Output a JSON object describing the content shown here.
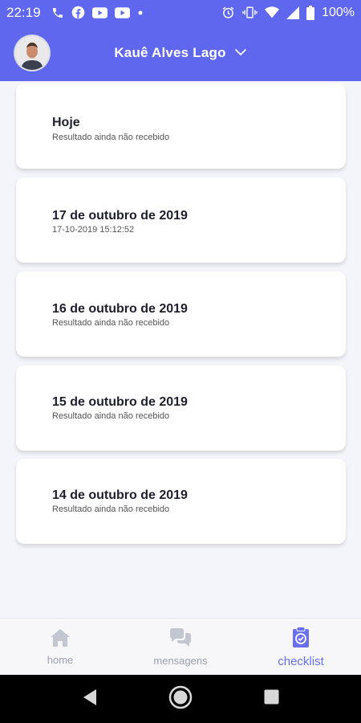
{
  "status_bar": {
    "time": "22:19",
    "battery": "100%",
    "left_icons": [
      "phone-icon",
      "facebook-icon",
      "youtube-icon",
      "youtube-icon",
      "dot-icon"
    ],
    "right_icons": [
      "alarm-icon",
      "vibrate-icon",
      "wifi-icon",
      "signal-icon",
      "battery-icon"
    ]
  },
  "header": {
    "user_name": "Kauê Alves Lago",
    "background": "#5f67ee"
  },
  "cards": [
    {
      "title": "Hoje",
      "subtitle": "Resultado ainda não recebido"
    },
    {
      "title": "17 de outubro de 2019",
      "subtitle": "17-10-2019 15:12:52"
    },
    {
      "title": "16 de outubro de 2019",
      "subtitle": "Resultado ainda não recebido"
    },
    {
      "title": "15 de outubro de 2019",
      "subtitle": "Resultado ainda não recebido"
    },
    {
      "title": "14 de outubro de 2019",
      "subtitle": "Resultado ainda não recebido"
    }
  ],
  "bottom_nav": {
    "items": [
      {
        "label": "home",
        "icon": "home-icon",
        "active": false
      },
      {
        "label": "mensagens",
        "icon": "chat-icon",
        "active": false
      },
      {
        "label": "checklist",
        "icon": "checklist-icon",
        "active": true
      }
    ],
    "active_color": "#6a6ff0",
    "inactive_color": "#c3c7d2"
  },
  "system_nav": [
    "back-icon",
    "home-circle-icon",
    "recents-icon"
  ]
}
